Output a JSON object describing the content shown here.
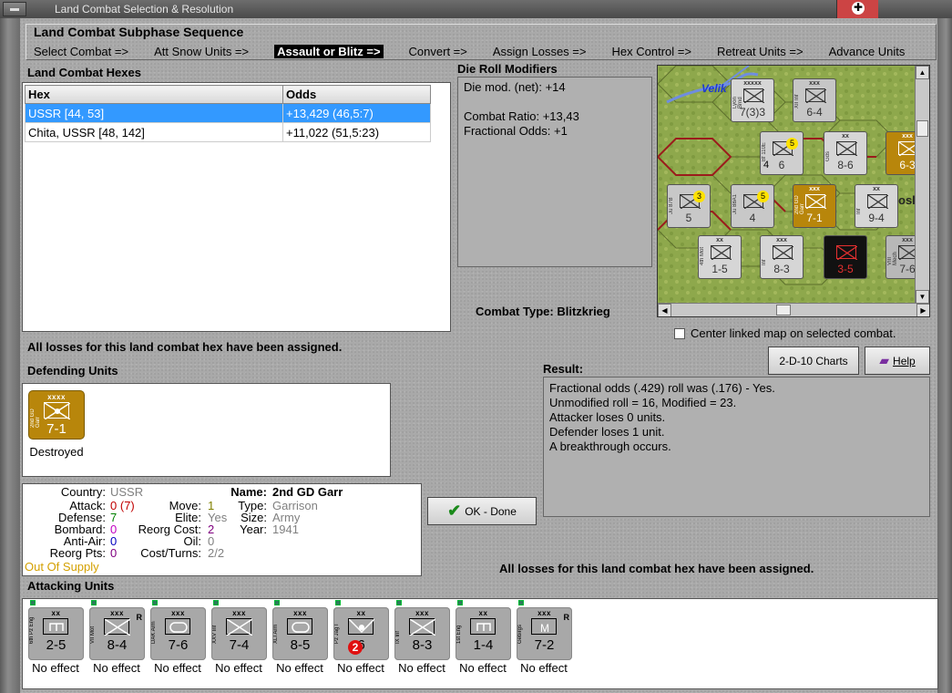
{
  "window": {
    "title": "Land Combat Selection & Resolution",
    "sys_button": "▬"
  },
  "sequence": {
    "title": "Land Combat Subphase Sequence",
    "steps": [
      {
        "label": "Select Combat =>",
        "active": false
      },
      {
        "label": "Att Snow Units =>",
        "active": false
      },
      {
        "label": "Assault or Blitz =>",
        "active": true
      },
      {
        "label": "Convert =>",
        "active": false
      },
      {
        "label": "Assign Losses =>",
        "active": false
      },
      {
        "label": "Hex Control =>",
        "active": false
      },
      {
        "label": "Retreat Units =>",
        "active": false
      },
      {
        "label": "Advance Units",
        "active": false
      }
    ]
  },
  "hexes": {
    "title": "Land Combat Hexes",
    "columns": [
      "Hex",
      "Odds"
    ],
    "rows": [
      {
        "hex": "USSR [44, 53]",
        "odds": "+13,429 (46,5:7)",
        "selected": true
      },
      {
        "hex": "Chita, USSR [48, 142]",
        "odds": "+11,022 (51,5:23)",
        "selected": false
      }
    ]
  },
  "drm": {
    "title": "Die Roll Modifiers",
    "lines": [
      "Die mod. (net): +14",
      "",
      "Combat Ratio: +13,43",
      "Fractional Odds: +1"
    ]
  },
  "combat_type": {
    "label": "Combat Type:",
    "value": "Blitzkrieg"
  },
  "map": {
    "place_label": "Velik",
    "place_label2": "osl",
    "counters": [
      {
        "size": "xxxxx",
        "vals": "7(3)3",
        "name": "Lyon Brnd"
      },
      {
        "size": "xxx",
        "vals": "6-4",
        "name": "XII Inf"
      },
      {
        "size": "xx",
        "vals": "8-6",
        "name": "Gds"
      },
      {
        "size": "xxx",
        "vals": "6-3",
        "name": ""
      },
      {
        "size": "",
        "vals": "6",
        "name": "Bf 110E",
        "circle": "5",
        "circle2": "4"
      },
      {
        "size": "",
        "vals": "5",
        "name": "Ju 87B",
        "circle": "3"
      },
      {
        "size": "",
        "vals": "4",
        "name": "Ju 88A1",
        "circle": "5"
      },
      {
        "size": "xxx",
        "vals": "7-1",
        "name": "2nd GD Garr"
      },
      {
        "size": "xx",
        "vals": "9-4",
        "name": "Inf"
      },
      {
        "size": "xx",
        "vals": "1-5",
        "name": "4th Mot"
      },
      {
        "size": "xxx",
        "vals": "8-3",
        "name": "Inf"
      },
      {
        "size": "",
        "vals": "3-5",
        "name": ""
      },
      {
        "size": "xxx",
        "vals": "7-6",
        "name": "VIII Mech"
      }
    ]
  },
  "center_linked": {
    "label": "Center linked map on selected combat."
  },
  "all_losses_text": "All losses for this land combat hex have been assigned.",
  "defending": {
    "title": "Defending Units",
    "units": [
      {
        "size": "xxxx",
        "name": "2nd GD Garr",
        "vals": "7-1",
        "status": "Destroyed",
        "color": "#b8860b"
      }
    ]
  },
  "info": {
    "country_label": "Country:",
    "country": "USSR",
    "attack_label": "Attack:",
    "attack": "0",
    "attack_paren": "(7)",
    "defense_label": "Defense:",
    "defense": "7",
    "bombard_label": "Bombard:",
    "bombard": "0",
    "antiair_label": "Anti-Air:",
    "antiair": "0",
    "reorg_label": "Reorg Pts:",
    "reorg": "0",
    "supply": "Out Of Supply",
    "move_label": "Move:",
    "move": "1",
    "elite_label": "Elite:",
    "elite": "Yes",
    "reorgcost_label": "Reorg Cost:",
    "reorgcost": "2",
    "oil_label": "Oil:",
    "oil": "0",
    "costturns_label": "Cost/Turns:",
    "costturns": "2/2",
    "name_label": "Name:",
    "name": "2nd GD Garr",
    "type_label": "Type:",
    "type": "Garrison",
    "size_label": "Size:",
    "size": "Army",
    "year_label": "Year:",
    "year": "1941"
  },
  "ok_button": {
    "label": "OK - Done"
  },
  "charts_button": {
    "label": "2-D-10 Charts"
  },
  "help_button": {
    "label": "Help"
  },
  "result": {
    "title": "Result:",
    "lines": [
      "Fractional odds (.429) roll was (.176)  - Yes.",
      "Unmodified roll = 16, Modified = 23.",
      "Attacker loses 0 units.",
      "Defender loses 1 unit.",
      "A breakthrough occurs."
    ]
  },
  "attacking": {
    "title": "Attacking Units",
    "units": [
      {
        "size": "xx",
        "name": "6th Pz Eng",
        "vals": "2-5",
        "status": "No effect",
        "res": "",
        "sym": "eng"
      },
      {
        "size": "xxx",
        "name": "VII Mot",
        "vals": "8-4",
        "status": "No effect",
        "res": "R",
        "sym": "inf"
      },
      {
        "size": "xxx",
        "name": "DAK Arm",
        "vals": "7-6",
        "status": "No effect",
        "res": "",
        "sym": "arm"
      },
      {
        "size": "xxx",
        "name": "XXV Inf",
        "vals": "7-4",
        "status": "No effect",
        "res": "",
        "sym": "inf"
      },
      {
        "size": "xxx",
        "name": "XLI Arm",
        "vals": "8-5",
        "status": "No effect",
        "res": "",
        "sym": "arm"
      },
      {
        "size": "xx",
        "name": "Pz Jag I",
        "vals": "6",
        "status": "No effect",
        "res": "",
        "sym": "at",
        "circle": "2"
      },
      {
        "size": "xxx",
        "name": "IX Inf",
        "vals": "8-3",
        "status": "No effect",
        "res": "",
        "sym": "inf"
      },
      {
        "size": "xx",
        "name": "1st Eng",
        "vals": "1-4",
        "status": "No effect",
        "res": "",
        "sym": "eng"
      },
      {
        "size": "xxx",
        "name": "Gebirgs",
        "vals": "7-2",
        "status": "No effect",
        "res": "R",
        "sym": "mtn"
      }
    ]
  },
  "colors": {
    "selected_row": "#3399ff",
    "german_counter": "#a8a8a8",
    "soviet_garr": "#b8860b",
    "ok_check": "#1a8a1a"
  }
}
